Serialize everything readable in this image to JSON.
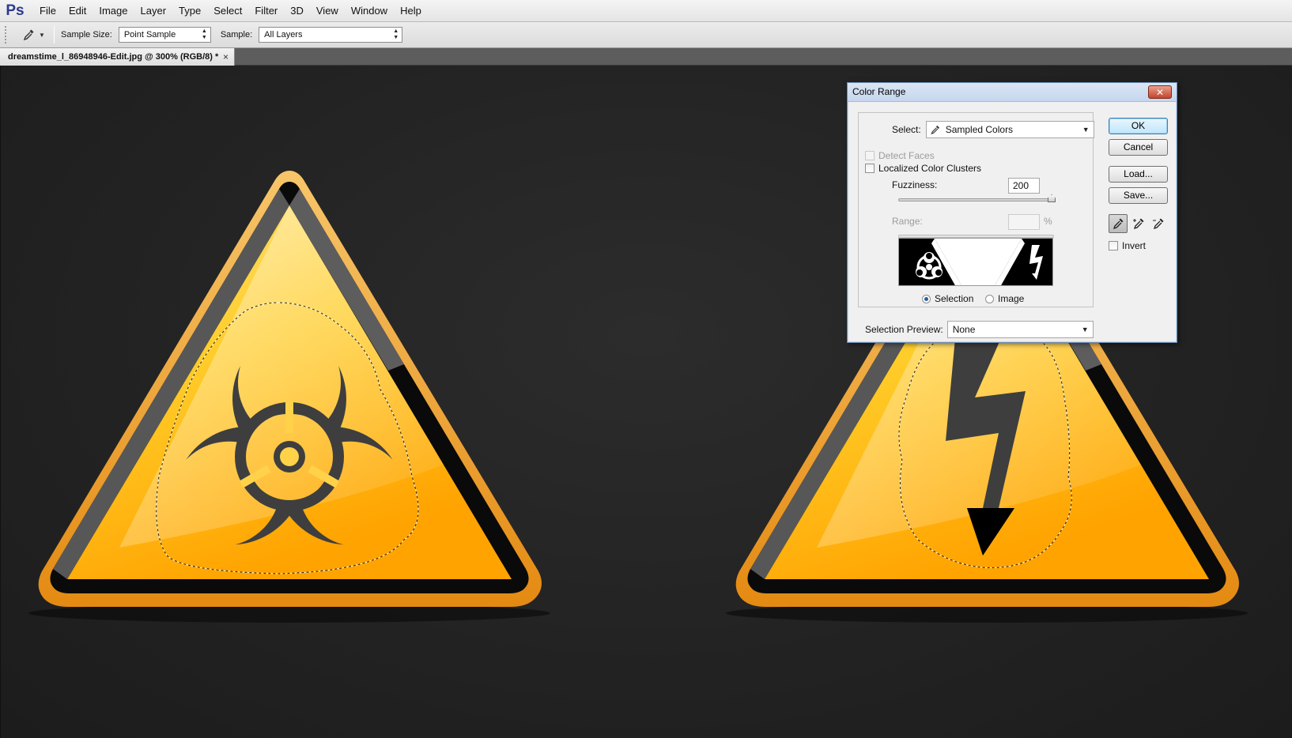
{
  "menubar": {
    "logo": "Ps",
    "items": [
      "File",
      "Edit",
      "Image",
      "Layer",
      "Type",
      "Select",
      "Filter",
      "3D",
      "View",
      "Window",
      "Help"
    ]
  },
  "options": {
    "sample_size_label": "Sample Size:",
    "sample_size_value": "Point Sample",
    "sample_label": "Sample:",
    "sample_value": "All Layers"
  },
  "document": {
    "tab_title": "dreamstime_l_86948946-Edit.jpg @ 300% (RGB/8) *",
    "tab_close": "×"
  },
  "dialog": {
    "title": "Color Range",
    "close_glyph": "✕",
    "select_label": "Select:",
    "select_value": "Sampled Colors",
    "detect_faces_label": "Detect Faces",
    "localized_clusters_label": "Localized Color Clusters",
    "fuzziness_label": "Fuzziness:",
    "fuzziness_value": "200",
    "range_label": "Range:",
    "range_value": "",
    "range_unit": "%",
    "radio_selection_label": "Selection",
    "radio_image_label": "Image",
    "selection_preview_label": "Selection Preview:",
    "selection_preview_value": "None",
    "buttons": {
      "ok": "OK",
      "cancel": "Cancel",
      "load": "Load...",
      "save": "Save..."
    },
    "invert_label": "Invert"
  },
  "colors": {
    "sign_yellow": "#ffc21a",
    "sign_orange": "#ffa000",
    "sign_border": "#f2a93a",
    "canvas_bg": "#222222",
    "accent_blue": "#3c7fb1"
  }
}
